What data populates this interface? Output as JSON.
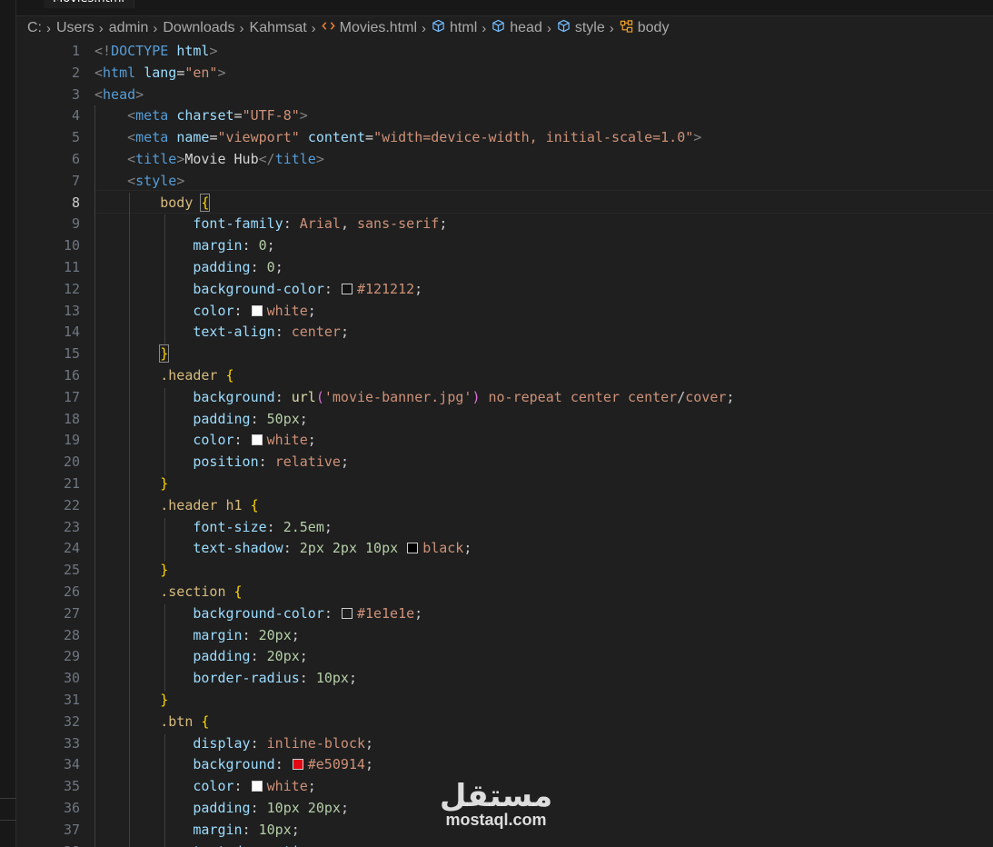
{
  "tab": {
    "label": "Movies.html"
  },
  "breadcrumb": {
    "items": [
      {
        "label": "C:",
        "icon": ""
      },
      {
        "label": "Users",
        "icon": ""
      },
      {
        "label": "admin",
        "icon": ""
      },
      {
        "label": "Downloads",
        "icon": ""
      },
      {
        "label": "Kahmsat",
        "icon": ""
      },
      {
        "label": "Movies.html",
        "icon": "html-file-icon"
      },
      {
        "label": "html",
        "icon": "cube-icon"
      },
      {
        "label": "head",
        "icon": "cube-icon"
      },
      {
        "label": "style",
        "icon": "cube-icon"
      },
      {
        "label": "body",
        "icon": "selector-icon"
      }
    ]
  },
  "editor": {
    "active_line": 8,
    "lines": [
      [
        [
          "p",
          "<!"
        ],
        [
          "t",
          "DOCTYPE"
        ],
        [
          "x",
          " "
        ],
        [
          "a",
          "html"
        ],
        [
          "p",
          ">"
        ]
      ],
      [
        [
          "p",
          "<"
        ],
        [
          "t",
          "html"
        ],
        [
          "x",
          " "
        ],
        [
          "a",
          "lang"
        ],
        [
          "x",
          "="
        ],
        [
          "s",
          "\"en\""
        ],
        [
          "p",
          ">"
        ]
      ],
      [
        [
          "p",
          "<"
        ],
        [
          "t",
          "head"
        ],
        [
          "p",
          ">"
        ]
      ],
      [
        [
          "x",
          "    "
        ],
        [
          "p",
          "<"
        ],
        [
          "t",
          "meta"
        ],
        [
          "x",
          " "
        ],
        [
          "a",
          "charset"
        ],
        [
          "x",
          "="
        ],
        [
          "s",
          "\"UTF-8\""
        ],
        [
          "p",
          ">"
        ]
      ],
      [
        [
          "x",
          "    "
        ],
        [
          "p",
          "<"
        ],
        [
          "t",
          "meta"
        ],
        [
          "x",
          " "
        ],
        [
          "a",
          "name"
        ],
        [
          "x",
          "="
        ],
        [
          "s",
          "\"viewport\""
        ],
        [
          "x",
          " "
        ],
        [
          "a",
          "content"
        ],
        [
          "x",
          "="
        ],
        [
          "s",
          "\"width=device-width, initial-scale=1.0\""
        ],
        [
          "p",
          ">"
        ]
      ],
      [
        [
          "x",
          "    "
        ],
        [
          "p",
          "<"
        ],
        [
          "t",
          "title"
        ],
        [
          "p",
          ">"
        ],
        [
          "x",
          "Movie Hub"
        ],
        [
          "p",
          "</"
        ],
        [
          "t",
          "title"
        ],
        [
          "p",
          ">"
        ]
      ],
      [
        [
          "x",
          "    "
        ],
        [
          "p",
          "<"
        ],
        [
          "t",
          "style"
        ],
        [
          "p",
          ">"
        ]
      ],
      [
        [
          "x",
          "        "
        ],
        [
          "sel",
          "body"
        ],
        [
          "x",
          " "
        ],
        [
          "bm",
          "{"
        ]
      ],
      [
        [
          "x",
          "            "
        ],
        [
          "prop",
          "font-family"
        ],
        [
          "pun",
          ": "
        ],
        [
          "val",
          "Arial"
        ],
        [
          "pun",
          ", "
        ],
        [
          "val",
          "sans-serif"
        ],
        [
          "pun",
          ";"
        ]
      ],
      [
        [
          "x",
          "            "
        ],
        [
          "prop",
          "margin"
        ],
        [
          "pun",
          ": "
        ],
        [
          "num",
          "0"
        ],
        [
          "pun",
          ";"
        ]
      ],
      [
        [
          "x",
          "            "
        ],
        [
          "prop",
          "padding"
        ],
        [
          "pun",
          ": "
        ],
        [
          "num",
          "0"
        ],
        [
          "pun",
          ";"
        ]
      ],
      [
        [
          "x",
          "            "
        ],
        [
          "prop",
          "background-color"
        ],
        [
          "pun",
          ": "
        ],
        [
          "sw",
          "#121212"
        ],
        [
          "val",
          "#121212"
        ],
        [
          "pun",
          ";"
        ]
      ],
      [
        [
          "x",
          "            "
        ],
        [
          "prop",
          "color"
        ],
        [
          "pun",
          ": "
        ],
        [
          "sw",
          "#ffffff"
        ],
        [
          "val",
          "white"
        ],
        [
          "pun",
          ";"
        ]
      ],
      [
        [
          "x",
          "            "
        ],
        [
          "prop",
          "text-align"
        ],
        [
          "pun",
          ": "
        ],
        [
          "val",
          "center"
        ],
        [
          "pun",
          ";"
        ]
      ],
      [
        [
          "x",
          "        "
        ],
        [
          "bm",
          "}"
        ]
      ],
      [
        [
          "x",
          "        "
        ],
        [
          "sel",
          ".header"
        ],
        [
          "x",
          " "
        ],
        [
          "b",
          "{"
        ]
      ],
      [
        [
          "x",
          "            "
        ],
        [
          "prop",
          "background"
        ],
        [
          "pun",
          ": "
        ],
        [
          "fn",
          "url"
        ],
        [
          "bb",
          "("
        ],
        [
          "val",
          "'movie-banner.jpg'"
        ],
        [
          "bb",
          ")"
        ],
        [
          "x",
          " "
        ],
        [
          "val",
          "no-repeat"
        ],
        [
          "x",
          " "
        ],
        [
          "val",
          "center"
        ],
        [
          "x",
          " "
        ],
        [
          "val",
          "center"
        ],
        [
          "pun",
          "/"
        ],
        [
          "val",
          "cover"
        ],
        [
          "pun",
          ";"
        ]
      ],
      [
        [
          "x",
          "            "
        ],
        [
          "prop",
          "padding"
        ],
        [
          "pun",
          ": "
        ],
        [
          "num",
          "50px"
        ],
        [
          "pun",
          ";"
        ]
      ],
      [
        [
          "x",
          "            "
        ],
        [
          "prop",
          "color"
        ],
        [
          "pun",
          ": "
        ],
        [
          "sw",
          "#ffffff"
        ],
        [
          "val",
          "white"
        ],
        [
          "pun",
          ";"
        ]
      ],
      [
        [
          "x",
          "            "
        ],
        [
          "prop",
          "position"
        ],
        [
          "pun",
          ": "
        ],
        [
          "val",
          "relative"
        ],
        [
          "pun",
          ";"
        ]
      ],
      [
        [
          "x",
          "        "
        ],
        [
          "b",
          "}"
        ]
      ],
      [
        [
          "x",
          "        "
        ],
        [
          "sel",
          ".header h1"
        ],
        [
          "x",
          " "
        ],
        [
          "b",
          "{"
        ]
      ],
      [
        [
          "x",
          "            "
        ],
        [
          "prop",
          "font-size"
        ],
        [
          "pun",
          ": "
        ],
        [
          "num",
          "2.5em"
        ],
        [
          "pun",
          ";"
        ]
      ],
      [
        [
          "x",
          "            "
        ],
        [
          "prop",
          "text-shadow"
        ],
        [
          "pun",
          ": "
        ],
        [
          "num",
          "2px"
        ],
        [
          "x",
          " "
        ],
        [
          "num",
          "2px"
        ],
        [
          "x",
          " "
        ],
        [
          "num",
          "10px"
        ],
        [
          "x",
          " "
        ],
        [
          "sw",
          "#000000"
        ],
        [
          "val",
          "black"
        ],
        [
          "pun",
          ";"
        ]
      ],
      [
        [
          "x",
          "        "
        ],
        [
          "b",
          "}"
        ]
      ],
      [
        [
          "x",
          "        "
        ],
        [
          "sel",
          ".section"
        ],
        [
          "x",
          " "
        ],
        [
          "b",
          "{"
        ]
      ],
      [
        [
          "x",
          "            "
        ],
        [
          "prop",
          "background-color"
        ],
        [
          "pun",
          ": "
        ],
        [
          "sw",
          "#1e1e1e"
        ],
        [
          "val",
          "#1e1e1e"
        ],
        [
          "pun",
          ";"
        ]
      ],
      [
        [
          "x",
          "            "
        ],
        [
          "prop",
          "margin"
        ],
        [
          "pun",
          ": "
        ],
        [
          "num",
          "20px"
        ],
        [
          "pun",
          ";"
        ]
      ],
      [
        [
          "x",
          "            "
        ],
        [
          "prop",
          "padding"
        ],
        [
          "pun",
          ": "
        ],
        [
          "num",
          "20px"
        ],
        [
          "pun",
          ";"
        ]
      ],
      [
        [
          "x",
          "            "
        ],
        [
          "prop",
          "border-radius"
        ],
        [
          "pun",
          ": "
        ],
        [
          "num",
          "10px"
        ],
        [
          "pun",
          ";"
        ]
      ],
      [
        [
          "x",
          "        "
        ],
        [
          "b",
          "}"
        ]
      ],
      [
        [
          "x",
          "        "
        ],
        [
          "sel",
          ".btn"
        ],
        [
          "x",
          " "
        ],
        [
          "b",
          "{"
        ]
      ],
      [
        [
          "x",
          "            "
        ],
        [
          "prop",
          "display"
        ],
        [
          "pun",
          ": "
        ],
        [
          "val",
          "inline-block"
        ],
        [
          "pun",
          ";"
        ]
      ],
      [
        [
          "x",
          "            "
        ],
        [
          "prop",
          "background"
        ],
        [
          "pun",
          ": "
        ],
        [
          "sw",
          "#e50914"
        ],
        [
          "val",
          "#e50914"
        ],
        [
          "pun",
          ";"
        ]
      ],
      [
        [
          "x",
          "            "
        ],
        [
          "prop",
          "color"
        ],
        [
          "pun",
          ": "
        ],
        [
          "sw",
          "#ffffff"
        ],
        [
          "val",
          "white"
        ],
        [
          "pun",
          ";"
        ]
      ],
      [
        [
          "x",
          "            "
        ],
        [
          "prop",
          "padding"
        ],
        [
          "pun",
          ": "
        ],
        [
          "num",
          "10px 20px"
        ],
        [
          "pun",
          ";"
        ]
      ],
      [
        [
          "x",
          "            "
        ],
        [
          "prop",
          "margin"
        ],
        [
          "pun",
          ": "
        ],
        [
          "num",
          "10px"
        ],
        [
          "pun",
          ";"
        ]
      ],
      [
        [
          "x",
          "            "
        ],
        [
          "prop",
          "text-decoration"
        ],
        [
          "pun",
          ": "
        ],
        [
          "val",
          "none"
        ],
        [
          "pun",
          ";"
        ]
      ]
    ]
  },
  "watermark": {
    "arabic": "مستقل",
    "latin": "mostaql.com"
  }
}
